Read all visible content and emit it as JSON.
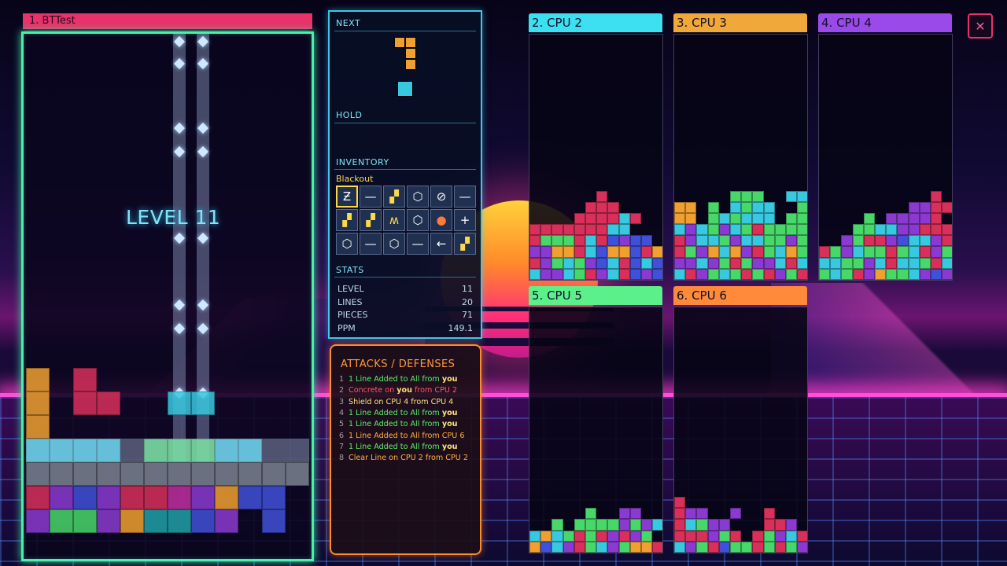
{
  "player": {
    "name": "1. BTTest",
    "level_banner": "LEVEL 11"
  },
  "next": {
    "label": "NEXT"
  },
  "hold": {
    "label": "HOLD"
  },
  "inventory": {
    "label": "INVENTORY",
    "selected_name": "Blackout",
    "items": [
      "blackout-icon",
      "line-icon",
      "mini-block-icon",
      "shield-icon",
      "no-icon",
      "line-icon",
      "mini-block-icon",
      "mini-block-icon",
      "zigzag-icon",
      "shield-icon",
      "bomb-icon",
      "plus-icon",
      "shield-icon",
      "line-icon",
      "shield-icon",
      "line-icon",
      "arrow-left-icon",
      "mini-block-icon"
    ]
  },
  "stats": {
    "label": "STATS",
    "rows": [
      {
        "label": "LEVEL",
        "value": "11"
      },
      {
        "label": "LINES",
        "value": "20"
      },
      {
        "label": "PIECES",
        "value": "71"
      },
      {
        "label": "PPM",
        "value": "149.1"
      }
    ]
  },
  "attacks": {
    "title": "ATTACKS / DEFENSES",
    "lines": [
      {
        "n": "1",
        "text": "1 Line Added to All from ",
        "who": "you",
        "color": "#5cf06a"
      },
      {
        "n": "2",
        "text": "Concrete on ",
        "who": "you",
        "tail": " from CPU 2",
        "color": "#ff5a6a"
      },
      {
        "n": "3",
        "text": "Shield on CPU 4 from CPU 4",
        "who": "",
        "color": "#ffe27a"
      },
      {
        "n": "4",
        "text": "1 Line Added to All from ",
        "who": "you",
        "color": "#5cf06a"
      },
      {
        "n": "5",
        "text": "1 Line Added to All from ",
        "who": "you",
        "color": "#5cf06a"
      },
      {
        "n": "6",
        "text": "1 Line Added to All from CPU 6",
        "who": "",
        "color": "#ffb040"
      },
      {
        "n": "7",
        "text": "1 Line Added to All from ",
        "who": "you",
        "color": "#5cf06a"
      },
      {
        "n": "8",
        "text": "Clear Line on CPU 2 from CPU 2",
        "who": "",
        "color": "#ffb040"
      }
    ]
  },
  "opponents": [
    {
      "name": "2. CPU 2",
      "color": "#3ce0f0"
    },
    {
      "name": "3. CPU 3",
      "color": "#f0a83a"
    },
    {
      "name": "4. CPU 4",
      "color": "#9a4ae8"
    },
    {
      "name": "5. CPU 5",
      "color": "#5cf08a"
    },
    {
      "name": "6. CPU 6",
      "color": "#ff8a3a"
    }
  ],
  "colors": {
    "red": "#d8305a",
    "cyan": "#38c8e0",
    "green": "#48d86a",
    "purple": "#8a3ad0",
    "orange": "#f0a030",
    "magenta": "#c030a0",
    "teal": "#20a0a8",
    "blue": "#4050d8"
  },
  "close": {
    "label": "✕"
  }
}
